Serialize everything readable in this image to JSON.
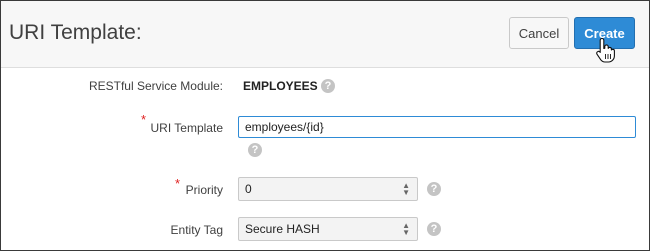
{
  "header": {
    "title": "URI Template:",
    "cancel_label": "Cancel",
    "create_label": "Create"
  },
  "form": {
    "module": {
      "label": "RESTful Service Module:",
      "value": "EMPLOYEES"
    },
    "uri_template": {
      "label": "URI Template",
      "value": "employees/{id}",
      "required": "*"
    },
    "priority": {
      "label": "Priority",
      "value": "0",
      "required": "*"
    },
    "entity_tag": {
      "label": "Entity Tag",
      "value": "Secure HASH"
    }
  },
  "icons": {
    "help": "?",
    "select_up": "▲",
    "select_down": "▼"
  },
  "colors": {
    "accent": "#2e8bd6",
    "required": "#e02020",
    "help_icon": "#c4c4c4"
  }
}
